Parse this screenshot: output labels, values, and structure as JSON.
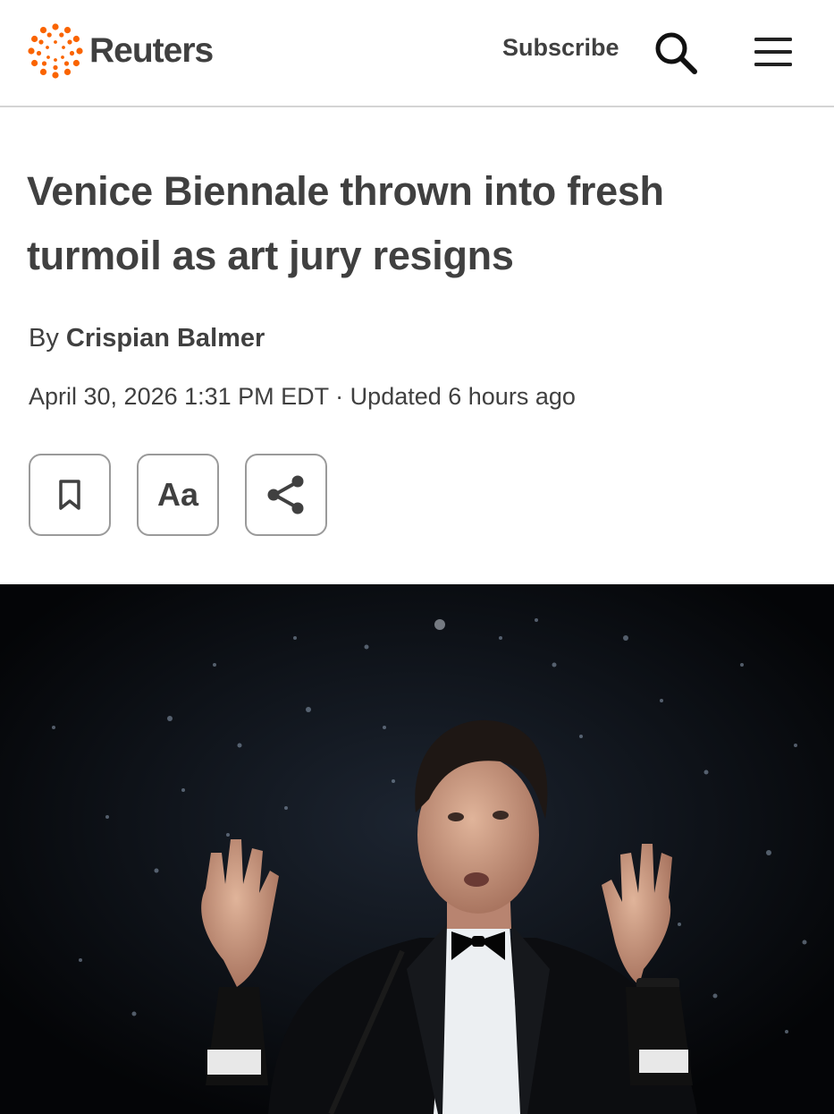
{
  "header": {
    "brand": "Reuters",
    "subscribe_label": "Subscribe",
    "logo_icon": "reuters-dot-ring-logo",
    "search_icon": "search-icon",
    "menu_icon": "hamburger-menu-icon"
  },
  "article": {
    "headline_line1": "Venice Biennale thrown into fresh",
    "headline_line2": "turmoil as art jury resigns",
    "byline_prefix": "By",
    "author": "Crispian Balmer",
    "dateline": "April 30, 2026 1:31 PM EDT · Updated 6 hours ago"
  },
  "toolbar": {
    "bookmark_icon": "bookmark-icon",
    "font_size_label": "Aa",
    "share_icon": "share-icon"
  },
  "hero_image": {
    "description_icon": "photo-man-in-tuxedo-on-stage"
  },
  "colors": {
    "brand_orange": "#fa6400",
    "text_dark": "#404040",
    "border_gray": "#9a9a9a"
  }
}
